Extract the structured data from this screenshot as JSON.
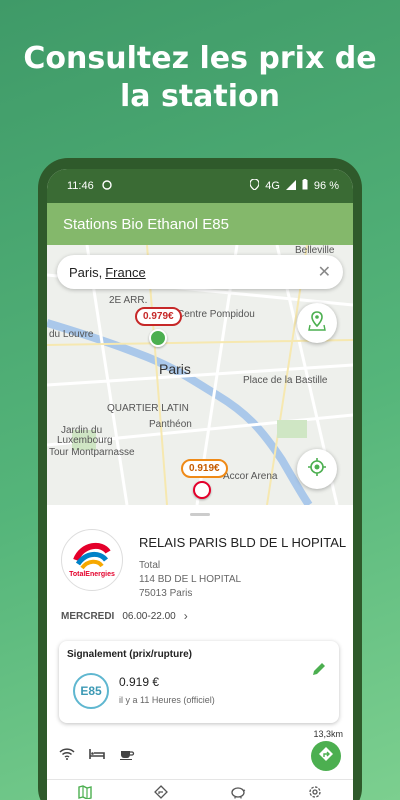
{
  "headline": {
    "line1": "Consultez les prix de",
    "line2": "la station"
  },
  "status_bar": {
    "time": "11:46",
    "network": "4G",
    "battery": "96 %"
  },
  "app_bar": {
    "title": "Stations Bio Ethanol E85"
  },
  "search": {
    "city": "Paris, ",
    "country": "France"
  },
  "map": {
    "labels": {
      "belleville": "Belleville",
      "arr2": "2E ARR.",
      "pompidou": "Centre Pompidou",
      "louvre": "du Louvre",
      "paris": "Paris",
      "bastille": "Place de la Bastille",
      "latin": "QUARTIER LATIN",
      "pantheon": "Panthéon",
      "jardin": "Jardin du",
      "luxembourg": "Luxembourg",
      "montparnasse": "Tour Montparnasse",
      "accor": "Accor Arena"
    },
    "prices": [
      {
        "value": "0.979€",
        "state": "high"
      },
      {
        "value": "0.919€",
        "state": "low"
      }
    ]
  },
  "station": {
    "name": "RELAIS PARIS BLD DE L HOPITAL",
    "brand": "Total",
    "brand_logo_text": "TotalEnergies",
    "street": "114 BD DE L HOPITAL",
    "city": "75013 Paris",
    "day": "MERCREDI",
    "hours": "06.00-22.00"
  },
  "report": {
    "title": "Signalement (prix/rupture)",
    "fuel": "E85",
    "price": "0.919 €",
    "updated": "il y a 11 Heures (officiel)"
  },
  "distance": "13,3km",
  "icons": {
    "amenities": [
      "wifi-icon",
      "bed-icon",
      "coffee-icon"
    ],
    "tabs": [
      "map-icon",
      "directions-icon",
      "piggy-bank-icon",
      "settings-icon"
    ]
  },
  "colors": {
    "primary": "#84b86b",
    "status": "#3a6b34",
    "accent": "#4caf50",
    "price_high": "#c62828",
    "price_low": "#ef8a17"
  }
}
